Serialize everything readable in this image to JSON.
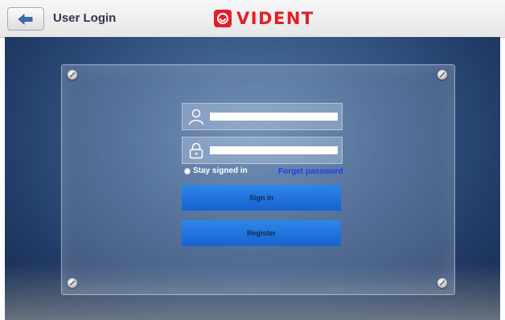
{
  "header": {
    "title": "User Login",
    "logo_text": "VIDENT",
    "back_icon": "back-arrow-icon"
  },
  "login": {
    "username": {
      "value": "",
      "icon": "user-icon"
    },
    "password": {
      "value": "",
      "icon": "lock-icon"
    },
    "stay_signed_in_label": "Stay signed in",
    "forget_password_label": "Forget password",
    "sign_in_label": "Sign in",
    "register_label": "Register"
  },
  "colors": {
    "brand": "#e21f26",
    "button": "#1f6fdc",
    "link": "#1d3df0"
  }
}
